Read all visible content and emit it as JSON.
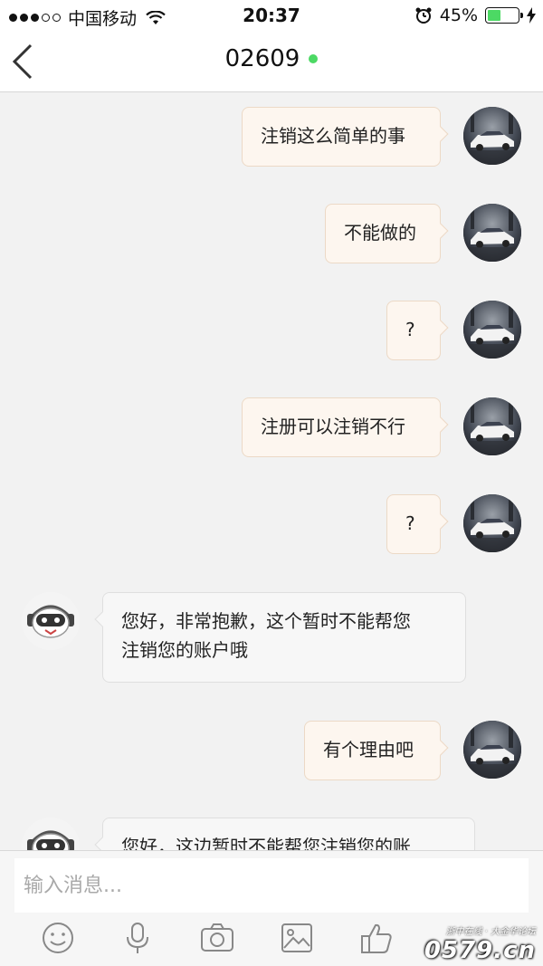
{
  "status_bar": {
    "carrier": "中国移动",
    "time": "20:37",
    "battery_percent": "45%",
    "battery_level": 0.45,
    "signal_bars": 3,
    "accent_color": "#4cd964"
  },
  "nav": {
    "title": "02609",
    "online": true,
    "back_icon": "chevron-left-icon"
  },
  "messages": [
    {
      "side": "out",
      "lines": [
        "注销这么简单的事"
      ]
    },
    {
      "side": "out",
      "lines": [
        "不能做的"
      ]
    },
    {
      "side": "out",
      "lines": [
        "?"
      ]
    },
    {
      "side": "out",
      "lines": [
        "注册可以注销不行"
      ]
    },
    {
      "side": "out",
      "lines": [
        "?"
      ]
    },
    {
      "side": "in",
      "lines": [
        "您好，非常抱歉，这个暂时不能帮您",
        "注销您的账户哦"
      ]
    },
    {
      "side": "out",
      "lines": [
        "有个理由吧"
      ]
    },
    {
      "side": "in",
      "lines": [
        "您好，这边暂时不能帮您注销您的账"
      ]
    }
  ],
  "input": {
    "placeholder": "输入消息..."
  },
  "toolbar": {
    "icons": [
      "emoji-icon",
      "microphone-icon",
      "camera-icon",
      "image-icon",
      "thumbs-up-icon"
    ]
  },
  "watermark": {
    "top": "浙中在线 · 大金华论坛",
    "main": "0579.cn"
  }
}
